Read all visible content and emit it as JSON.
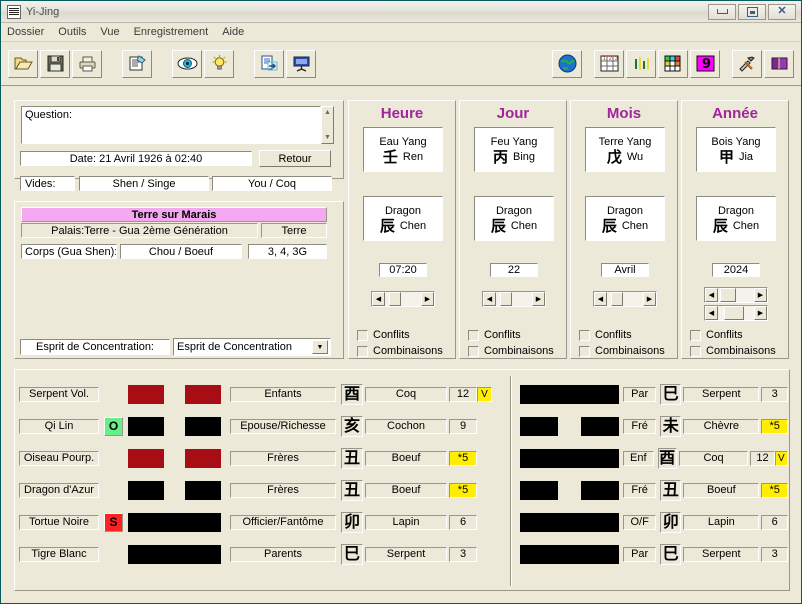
{
  "window": {
    "title": "Yi-Jing",
    "icon": "document-lines-icon",
    "buttons": {
      "minimize": "minimize",
      "maximize": "maximize",
      "close": "close"
    }
  },
  "menu": {
    "items": [
      "Dossier",
      "Outils",
      "Vue",
      "Enregistrement",
      "Aide"
    ]
  },
  "toolbar": {
    "groups": [
      {
        "buttons": [
          {
            "name": "open-icon",
            "glyph": "open-folder"
          },
          {
            "name": "save-icon",
            "glyph": "floppy-disk"
          },
          {
            "name": "print-icon",
            "glyph": "printer"
          }
        ]
      },
      {
        "buttons": [
          {
            "name": "new-record-icon",
            "glyph": "document-pencil"
          }
        ]
      },
      {
        "buttons": [
          {
            "name": "eye-icon",
            "glyph": "eye"
          },
          {
            "name": "lightbulb-icon",
            "glyph": "lightbulb"
          }
        ]
      },
      {
        "buttons": [
          {
            "name": "export-icon",
            "glyph": "document-arrow"
          },
          {
            "name": "presentation-icon",
            "glyph": "screen"
          }
        ]
      },
      {
        "buttons": [
          {
            "name": "globe-icon",
            "glyph": "globe"
          }
        ]
      },
      {
        "buttons": [
          {
            "name": "numbers-table-icon",
            "glyph": "number-grid"
          },
          {
            "name": "bar-chart-icon",
            "glyph": "bars"
          },
          {
            "name": "color-grid-icon",
            "glyph": "color-grid"
          },
          {
            "name": "nine-star-icon",
            "glyph": "9",
            "color": "#ff00ff"
          }
        ]
      },
      {
        "buttons": [
          {
            "name": "tools-icon",
            "glyph": "hammer-wrench"
          },
          {
            "name": "book-icon",
            "glyph": "book"
          }
        ]
      }
    ]
  },
  "question": {
    "label": "Question:",
    "placeholder": "Question:",
    "value": ""
  },
  "date": {
    "text": "Date: 21 Avril 1926 à 02:40"
  },
  "retour_button": "Retour",
  "vides": {
    "label": "Vides:",
    "value1": "Shen / Singe",
    "value2": "You / Coq"
  },
  "gua": {
    "title": "Terre sur Marais",
    "palais": "Palais:Terre  -  Gua 2ème Génération",
    "element": "Terre",
    "corps_label": "Corps (Gua Shen):",
    "corps_value": "Chou / Boeuf",
    "corps_numbers": "3, 4, 3G"
  },
  "esprit": {
    "label": "Esprit de Concentration:",
    "selected": "Esprit de Concentration"
  },
  "pillars": [
    {
      "title": "Heure",
      "stem": {
        "element": "Eau Yang",
        "han": "壬",
        "roman": "Ren"
      },
      "branch": {
        "animal": "Dragon",
        "han": "辰",
        "roman": "Chen"
      },
      "value": "07:20",
      "checks": [
        "Conflits",
        "Combinaisons"
      ],
      "scrollbars": 1
    },
    {
      "title": "Jour",
      "stem": {
        "element": "Feu Yang",
        "han": "丙",
        "roman": "Bing"
      },
      "branch": {
        "animal": "Dragon",
        "han": "辰",
        "roman": "Chen"
      },
      "value": "22",
      "checks": [
        "Conflits",
        "Combinaisons"
      ],
      "scrollbars": 1
    },
    {
      "title": "Mois",
      "stem": {
        "element": "Terre Yang",
        "han": "戊",
        "roman": "Wu"
      },
      "branch": {
        "animal": "Dragon",
        "han": "辰",
        "roman": "Chen"
      },
      "value": "Avril",
      "checks": [
        "Conflits",
        "Combinaisons"
      ],
      "scrollbars": 1
    },
    {
      "title": "Année",
      "stem": {
        "element": "Bois Yang",
        "han": "甲",
        "roman": "Jia"
      },
      "branch": {
        "animal": "Dragon",
        "han": "辰",
        "roman": "Chen"
      },
      "value": "2024",
      "checks": [
        "Conflits",
        "Combinaisons"
      ],
      "scrollbars": 2
    }
  ],
  "hexagram_left": {
    "rows": [
      {
        "spirit": "Serpent Vol.",
        "badge": "",
        "badge_color": "",
        "line": "broken",
        "line_color": "#a80d16",
        "relation": "Enfants",
        "han": "酉",
        "animal": "Coq",
        "num": "12",
        "num_highlight": false,
        "marker": "V"
      },
      {
        "spirit": "Qi Lin",
        "badge": "O",
        "badge_color": "#66ee88",
        "line": "broken",
        "line_color": "#000000",
        "relation": "Epouse/Richesse",
        "han": "亥",
        "animal": "Cochon",
        "num": "9",
        "num_highlight": false,
        "marker": ""
      },
      {
        "spirit": "Oiseau Pourp.",
        "badge": "",
        "badge_color": "",
        "line": "broken",
        "line_color": "#a80d16",
        "relation": "Frères",
        "han": "丑",
        "animal": "Boeuf",
        "num": "*5",
        "num_highlight": true,
        "marker": ""
      },
      {
        "spirit": "Dragon d'Azur",
        "badge": "",
        "badge_color": "",
        "line": "broken",
        "line_color": "#000000",
        "relation": "Frères",
        "han": "丑",
        "animal": "Boeuf",
        "num": "*5",
        "num_highlight": true,
        "marker": ""
      },
      {
        "spirit": "Tortue Noire",
        "badge": "S",
        "badge_color": "#ff2222",
        "line": "solid",
        "line_color": "#000000",
        "relation": "Officier/Fantôme",
        "han": "卯",
        "animal": "Lapin",
        "num": "6",
        "num_highlight": false,
        "marker": ""
      },
      {
        "spirit": "Tigre Blanc",
        "badge": "",
        "badge_color": "",
        "line": "solid",
        "line_color": "#000000",
        "relation": "Parents",
        "han": "巳",
        "animal": "Serpent",
        "num": "3",
        "num_highlight": false,
        "marker": ""
      }
    ]
  },
  "hexagram_right": {
    "rows": [
      {
        "line": "solid",
        "line_color": "#000000",
        "relation": "Par",
        "han": "巳",
        "animal": "Serpent",
        "num": "3",
        "num_highlight": false,
        "marker": ""
      },
      {
        "line": "broken",
        "line_color": "#000000",
        "relation": "Fré",
        "han": "未",
        "animal": "Chèvre",
        "num": "*5",
        "num_highlight": true,
        "marker": ""
      },
      {
        "line": "solid",
        "line_color": "#000000",
        "relation": "Enf",
        "han": "酉",
        "animal": "Coq",
        "num": "12",
        "num_highlight": false,
        "marker": "V"
      },
      {
        "line": "broken",
        "line_color": "#000000",
        "relation": "Fré",
        "han": "丑",
        "animal": "Boeuf",
        "num": "*5",
        "num_highlight": true,
        "marker": ""
      },
      {
        "line": "solid",
        "line_color": "#000000",
        "relation": "O/F",
        "han": "卯",
        "animal": "Lapin",
        "num": "6",
        "num_highlight": false,
        "marker": ""
      },
      {
        "line": "solid",
        "line_color": "#000000",
        "relation": "Par",
        "han": "巳",
        "animal": "Serpent",
        "num": "3",
        "num_highlight": false,
        "marker": ""
      }
    ]
  },
  "colors": {
    "title_accent": "#a0279b",
    "gua_title_bg": "#f3a8ef",
    "highlight": "#ffee00",
    "yang_red": "#a80d16",
    "window_bg": "#ece9d8"
  }
}
